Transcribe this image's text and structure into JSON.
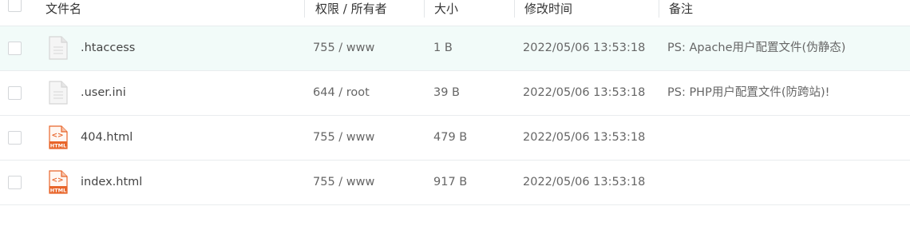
{
  "header": {
    "name": "文件名",
    "permission_owner": "权限 / 所有者",
    "size": "大小",
    "modified": "修改时间",
    "remark": "备注"
  },
  "rows": [
    {
      "name": ".htaccess",
      "icon": "file-generic-icon",
      "perm": "755 / www",
      "size": "1 B",
      "modified": "2022/05/06 13:53:18",
      "remark": "PS: Apache用户配置文件(伪静态)"
    },
    {
      "name": ".user.ini",
      "icon": "file-generic-icon",
      "perm": "644 / root",
      "size": "39 B",
      "modified": "2022/05/06 13:53:18",
      "remark": "PS: PHP用户配置文件(防跨站)!"
    },
    {
      "name": "404.html",
      "icon": "html-file-icon",
      "perm": "755 / www",
      "size": "479 B",
      "modified": "2022/05/06 13:53:18",
      "remark": ""
    },
    {
      "name": "index.html",
      "icon": "html-file-icon",
      "perm": "755 / www",
      "size": "917 B",
      "modified": "2022/05/06 13:53:18",
      "remark": ""
    }
  ],
  "icons": {
    "html_badge": "HTML",
    "html_glyph": "<>"
  },
  "colors": {
    "highlight_row": "#f2fbf9",
    "html_icon": "#e8652a",
    "generic_icon": "#d5d5d5"
  }
}
